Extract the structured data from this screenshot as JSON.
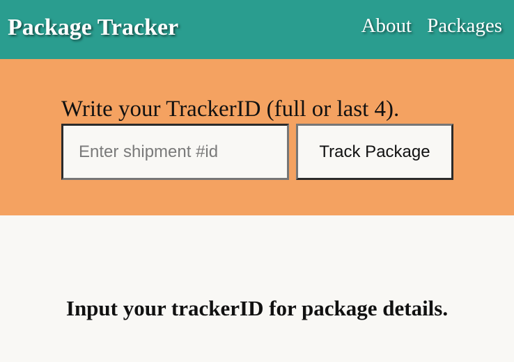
{
  "navbar": {
    "brand": "Package Tracker",
    "links": [
      "About",
      "Packages"
    ]
  },
  "tracker": {
    "prompt": "Write your TrackerID (full or last 4).",
    "input_value": "",
    "input_placeholder": "Enter shipment #id",
    "button_label": "Track Package"
  },
  "result": {
    "message": "Input your trackerID for package details."
  },
  "colors": {
    "navbar": "#2a9d8f",
    "hero": "#f4a261",
    "page_background": "#f9f8f5"
  }
}
